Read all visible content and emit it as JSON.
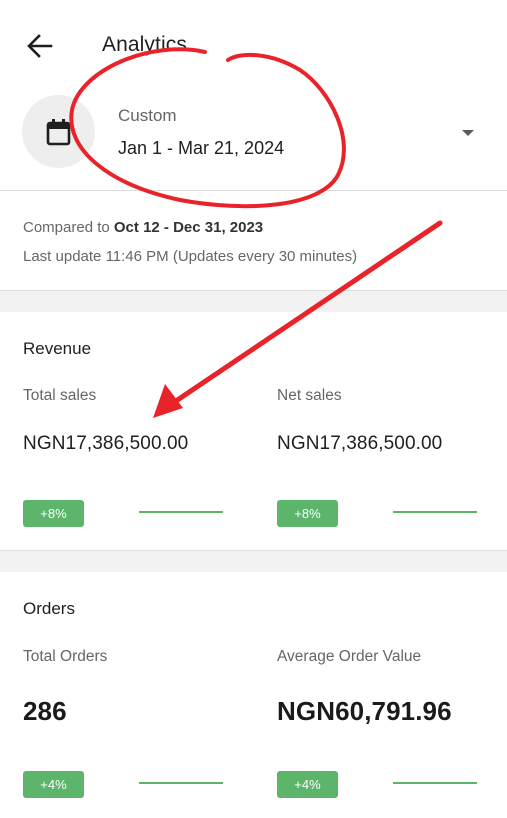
{
  "header": {
    "title": "Analytics",
    "back_icon": "arrow-left-icon"
  },
  "date_range": {
    "label": "Custom",
    "value": "Jan 1 - Mar 21, 2024",
    "icon": "calendar-icon"
  },
  "comparison": {
    "prefix": "Compared to ",
    "period": "Oct 12 - Dec 31, 2023",
    "last_update": "Last update 11:46 PM (Updates every 30 minutes)"
  },
  "revenue": {
    "title": "Revenue",
    "total_sales": {
      "label": "Total sales",
      "value": "NGN17,386,500.00",
      "change": "+8%"
    },
    "net_sales": {
      "label": "Net sales",
      "value": "NGN17,386,500.00",
      "change": "+8%"
    }
  },
  "orders": {
    "title": "Orders",
    "total_orders": {
      "label": "Total Orders",
      "value": "286",
      "change": "+4%"
    },
    "avg_order_value": {
      "label": "Average Order Value",
      "value": "NGN60,791.96",
      "change": "+4%"
    }
  },
  "colors": {
    "positive": "#5cb56a",
    "annotation": "#e8232a"
  }
}
